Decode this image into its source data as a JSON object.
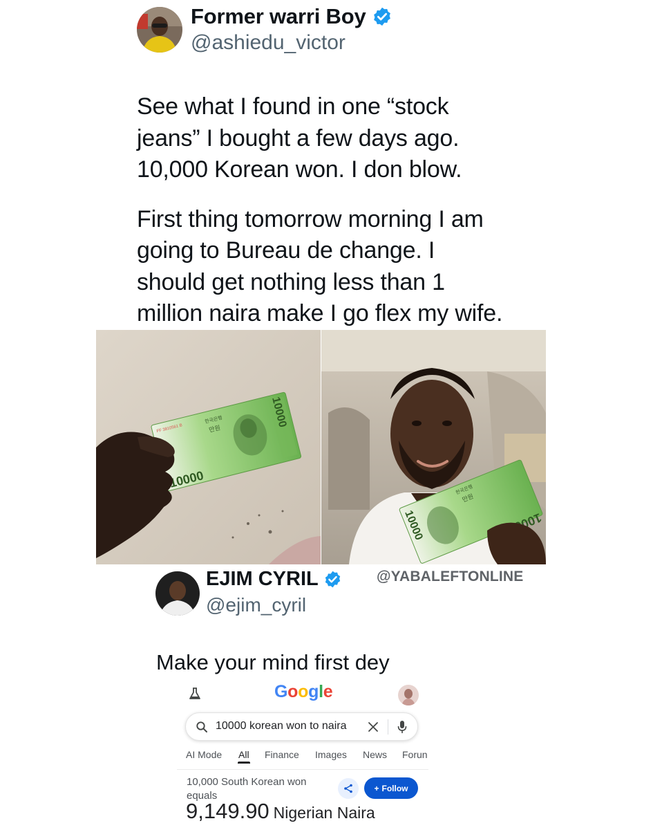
{
  "tweet1": {
    "author_name": "Former warri Boy",
    "author_handle": "@ashiedu_victor",
    "paragraph1": "See what I found in one “stock\njeans” I bought a few days ago.\n10,000 Korean won. I don blow.",
    "paragraph2": "First thing tomorrow morning I am\ngoing to Bureau de change. I\nshould get nothing less than 1\nmillion naira make I go flex my wife.",
    "photo1": {
      "banknote_value": "10000",
      "banknote_serial": "FF 3810561 B",
      "banknote_hangul": "한국은행",
      "banknote_denom": "만원"
    },
    "photo2": {
      "banknote_value": "10000",
      "banknote_hangul": "한국은행",
      "banknote_denom": "만원"
    }
  },
  "watermark": "@YABALEFTONLINE",
  "tweet2": {
    "author_name": "EJIM CYRIL",
    "author_handle": "@ejim_cyril",
    "text": "Make your mind first dey"
  },
  "google": {
    "logo_letters": [
      {
        "char": "G",
        "color": "#4285F4"
      },
      {
        "char": "o",
        "color": "#EA4335"
      },
      {
        "char": "o",
        "color": "#FBBC05"
      },
      {
        "char": "g",
        "color": "#4285F4"
      },
      {
        "char": "l",
        "color": "#34A853"
      },
      {
        "char": "e",
        "color": "#EA4335"
      }
    ],
    "search_query": "10000 korean won to naira",
    "tabs": [
      "AI Mode",
      "All",
      "Finance",
      "Images",
      "News",
      "Forun"
    ],
    "active_tab": "All",
    "result_label": "10,000 South Korean won equals",
    "result_value": "9,149.90",
    "result_unit": "Nigerian Naira",
    "follow_label": "Follow",
    "follow_plus": "+"
  },
  "colors": {
    "verified_blue": "#1d9bf0",
    "text_primary": "#0f1419",
    "text_secondary": "#536471",
    "google_blue_button": "#0b57d0"
  },
  "icons": [
    "verified-badge-icon",
    "labs-flask-icon",
    "search-icon",
    "clear-icon",
    "microphone-icon",
    "share-icon"
  ]
}
